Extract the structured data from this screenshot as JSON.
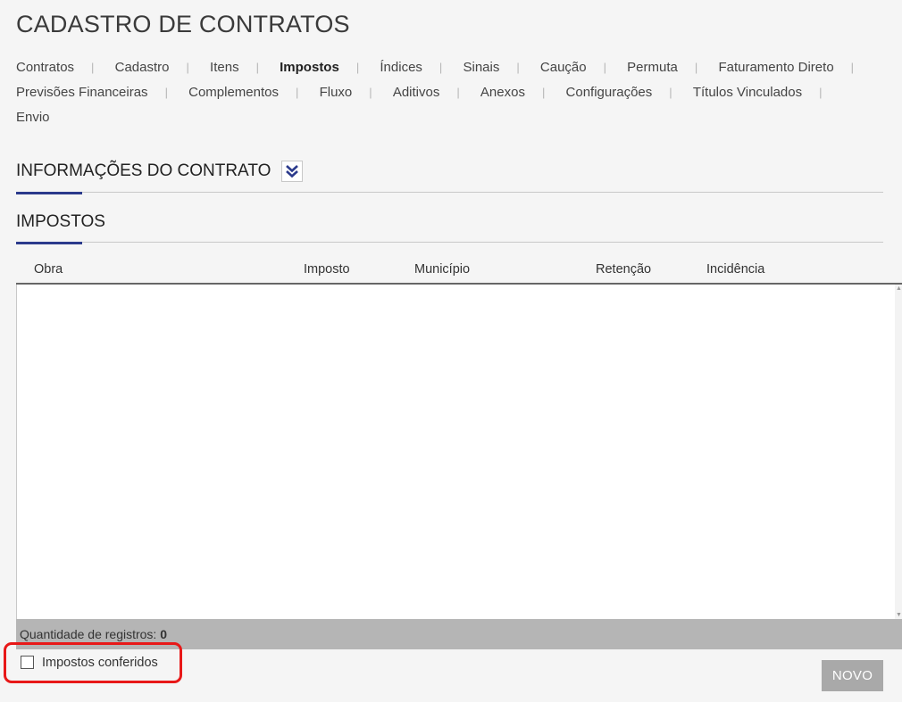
{
  "page": {
    "title": "CADASTRO DE CONTRATOS"
  },
  "nav": {
    "items": [
      {
        "label": "Contratos",
        "active": false
      },
      {
        "label": "Cadastro",
        "active": false
      },
      {
        "label": "Itens",
        "active": false
      },
      {
        "label": "Impostos",
        "active": true
      },
      {
        "label": "Índices",
        "active": false
      },
      {
        "label": "Sinais",
        "active": false
      },
      {
        "label": "Caução",
        "active": false
      },
      {
        "label": "Permuta",
        "active": false
      },
      {
        "label": "Faturamento Direto",
        "active": false
      },
      {
        "label": "Previsões Financeiras",
        "active": false
      },
      {
        "label": "Complementos",
        "active": false
      },
      {
        "label": "Fluxo",
        "active": false
      },
      {
        "label": "Aditivos",
        "active": false
      },
      {
        "label": "Anexos",
        "active": false
      },
      {
        "label": "Configurações",
        "active": false
      },
      {
        "label": "Títulos Vinculados",
        "active": false
      },
      {
        "label": "Envio",
        "active": false
      }
    ],
    "separator": "|"
  },
  "sections": {
    "info": {
      "title": "INFORMAÇÕES DO CONTRATO",
      "expand_icon": "double-chevron-down-icon"
    },
    "impostos": {
      "title": "IMPOSTOS"
    }
  },
  "grid": {
    "columns": [
      "Obra",
      "Imposto",
      "Município",
      "Retenção",
      "Incidência"
    ],
    "rows": [],
    "footer": {
      "label": "Quantidade de registros:",
      "count": "0"
    }
  },
  "form": {
    "impostos_conferidos_label": "Impostos conferidos",
    "impostos_conferidos_checked": false,
    "novo_label": "NOVO"
  },
  "colors": {
    "accent": "#2b3a8c",
    "highlight": "#e81818",
    "button_bg": "#a9a9a9",
    "footer_bg": "#b5b5b5",
    "page_bg": "#f5f5f5"
  }
}
